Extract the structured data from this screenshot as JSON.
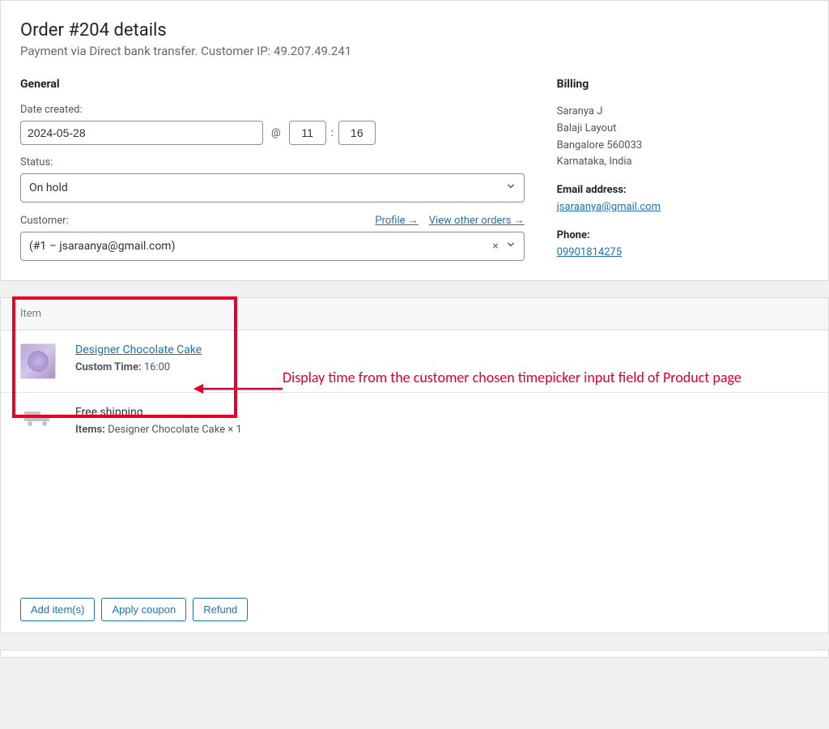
{
  "header": {
    "title": "Order #204 details",
    "subtitle": "Payment via Direct bank transfer. Customer IP: 49.207.49.241"
  },
  "general": {
    "heading": "General",
    "date_label": "Date created:",
    "date_value": "2024-05-28",
    "at_symbol": "@",
    "hour_value": "11",
    "time_sep": ":",
    "minute_value": "16",
    "status_label": "Status:",
    "status_value": "On hold",
    "customer_label": "Customer:",
    "profile_link": "Profile →",
    "view_orders_link": "View other orders →",
    "customer_value": "(#1 – jsaraanya@gmail.com)"
  },
  "billing": {
    "heading": "Billing",
    "lines": [
      "Saranya J",
      "Balaji Layout",
      "Bangalore 560033",
      "Karnataka, India"
    ],
    "email_label": "Email address:",
    "email_value": "jsaraanya@gmail.com",
    "phone_label": "Phone:",
    "phone_value": "09901814275"
  },
  "items": {
    "header": "Item",
    "product_name": "Designer Chocolate Cake",
    "custom_time_label": "Custom Time:",
    "custom_time_value": "16:00",
    "shipping_name": "Free shipping",
    "shipping_items_label": "Items:",
    "shipping_items_value": "Designer Chocolate Cake × 1"
  },
  "annotation": {
    "text": "Display time from the customer chosen timepicker input field of Product page"
  },
  "actions": {
    "add_items": "Add item(s)",
    "apply_coupon": "Apply coupon",
    "refund": "Refund"
  }
}
